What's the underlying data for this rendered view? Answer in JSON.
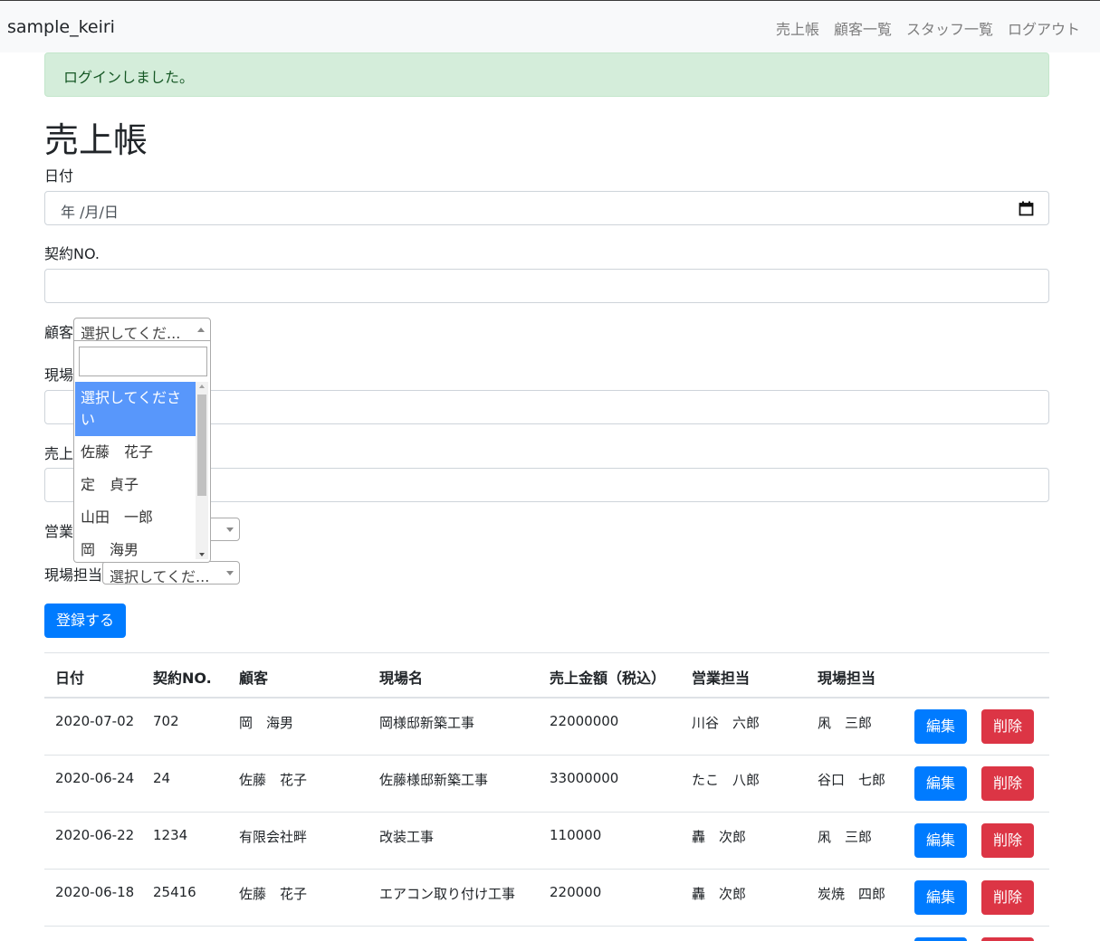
{
  "navbar": {
    "brand": "sample_keiri",
    "links": [
      "売上帳",
      "顧客一覧",
      "スタッフ一覧",
      "ログアウト"
    ]
  },
  "alert": "ログインしました。",
  "page_title": "売上帳",
  "form": {
    "date_label": "日付",
    "date_value": "年 /月/日",
    "contract_label": "契約NO.",
    "customer_label": "顧客",
    "customer_select": "選択してくだ...",
    "site_label": "現場",
    "sales_label": "売上",
    "sales_staff_label": "営業",
    "site_staff_label": "現場担当",
    "site_staff_select": "選択してくだ...",
    "submit": "登録する"
  },
  "dropdown": {
    "options": [
      "選択してください",
      "佐藤　花子",
      "定　貞子",
      "山田　一郎",
      "岡　海男"
    ],
    "selected": "選択してください"
  },
  "table": {
    "headers": [
      "日付",
      "契約NO.",
      "顧客",
      "現場名",
      "売上金額（税込）",
      "営業担当",
      "現場担当"
    ],
    "rows": [
      [
        "2020-07-02",
        "702",
        "岡　海男",
        "岡様邸新築工事",
        "22000000",
        "川谷　六郎",
        "凩　三郎"
      ],
      [
        "2020-06-24",
        "24",
        "佐藤　花子",
        "佐藤様邸新築工事",
        "33000000",
        "たこ　八郎",
        "谷口　七郎"
      ],
      [
        "2020-06-22",
        "1234",
        "有限会社畔",
        "改装工事",
        "110000",
        "轟　次郎",
        "凩　三郎"
      ],
      [
        "2020-06-18",
        "25416",
        "佐藤　花子",
        "エアコン取り付け工事",
        "220000",
        "轟　次郎",
        "炭焼　四郎"
      ]
    ],
    "edit_label": "編集",
    "delete_label": "削除"
  }
}
